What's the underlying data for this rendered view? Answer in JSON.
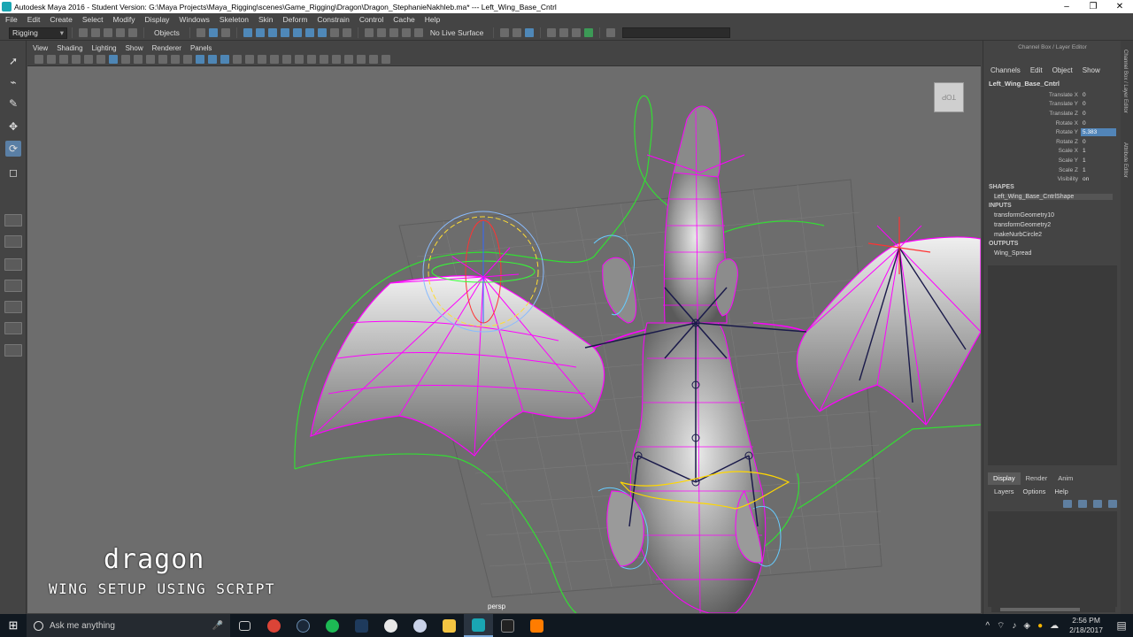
{
  "window": {
    "title": "Autodesk Maya 2016 - Student Version: G:\\Maya Projects\\Maya_Rigging\\scenes\\Game_Rigging\\Dragon\\Dragon_StephanieNakhleb.ma*  ---  Left_Wing_Base_Cntrl",
    "minimize": "–",
    "restore": "❐",
    "close": "✕"
  },
  "menubar": [
    "File",
    "Edit",
    "Create",
    "Select",
    "Modify",
    "Display",
    "Windows",
    "Skeleton",
    "Skin",
    "Deform",
    "Constrain",
    "Control",
    "Cache",
    "Help"
  ],
  "statusline": {
    "mode": "Rigging",
    "objects_label": "Objects",
    "live_surface": "No Live Surface"
  },
  "panel_menu": [
    "View",
    "Shading",
    "Lighting",
    "Show",
    "Renderer",
    "Panels"
  ],
  "viewport": {
    "camera": "persp",
    "viewcube_label": "TOP",
    "overlay_title": "dragon",
    "overlay_subtitle": "wing setup using script"
  },
  "channel_box": {
    "header": "Channel Box / Layer Editor",
    "menu": [
      "Channels",
      "Edit",
      "Object",
      "Show"
    ],
    "object": "Left_Wing_Base_Cntrl",
    "attributes": [
      {
        "label": "Translate X",
        "value": "0"
      },
      {
        "label": "Translate Y",
        "value": "0"
      },
      {
        "label": "Translate Z",
        "value": "0"
      },
      {
        "label": "Rotate X",
        "value": "0"
      },
      {
        "label": "Rotate Y",
        "value": "5.383"
      },
      {
        "label": "Rotate Z",
        "value": "0"
      },
      {
        "label": "Scale X",
        "value": "1"
      },
      {
        "label": "Scale Y",
        "value": "1"
      },
      {
        "label": "Scale Z",
        "value": "1"
      },
      {
        "label": "Visibility",
        "value": "on"
      }
    ],
    "shapes_title": "SHAPES",
    "shapes": [
      "Left_Wing_Base_CntrlShape"
    ],
    "inputs_title": "INPUTS",
    "inputs": [
      "transformGeometry10",
      "transformGeometry2",
      "makeNurbCircle2"
    ],
    "outputs_title": "OUTPUTS",
    "outputs": [
      "Wing_Spread"
    ]
  },
  "layer_editor": {
    "tabs": [
      "Display",
      "Render",
      "Anim"
    ],
    "menu": [
      "Layers",
      "Options",
      "Help"
    ]
  },
  "side_tabs": [
    "Channel Box / Layer Editor",
    "Attribute Editor"
  ],
  "taskbar": {
    "search_placeholder": "Ask me anything",
    "time": "2:56 PM",
    "date": "2/18/2017"
  },
  "colors": {
    "viewport_bg": "#6d6d6d",
    "rig_magenta": "#ff00ff",
    "curve_green": "#33dd33",
    "selection_blue": "#5285b8"
  }
}
